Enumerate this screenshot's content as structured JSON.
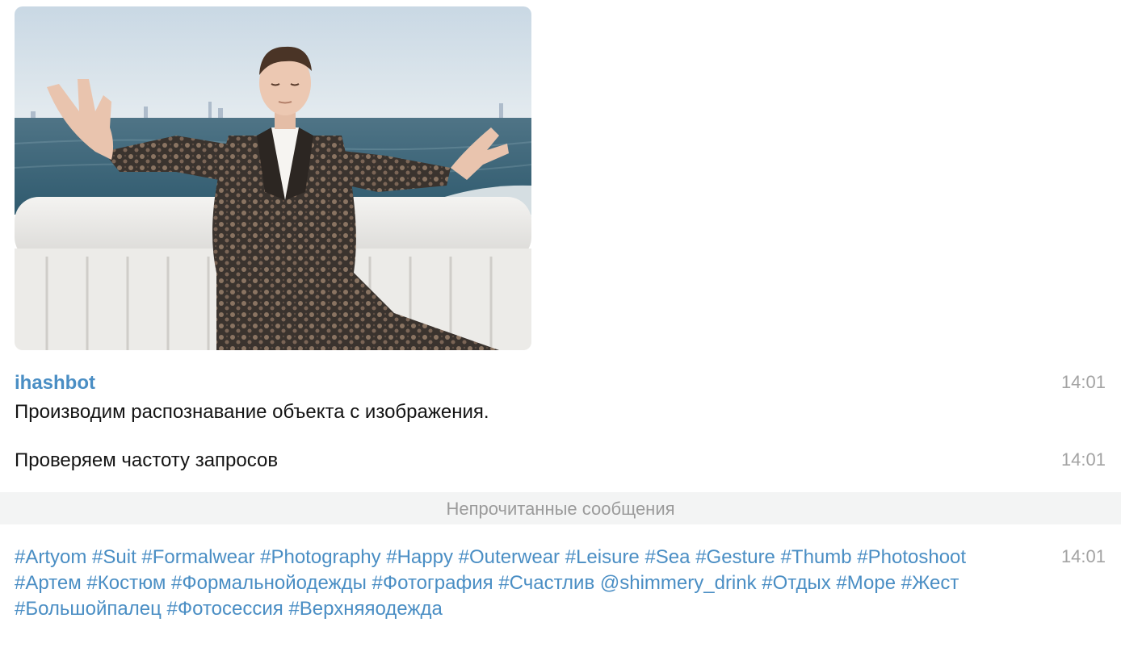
{
  "photo": {
    "alt_subject": "photo"
  },
  "messages": [
    {
      "sender": "ihashbot",
      "text": "Производим распознавание объекта с изображения.",
      "time": "14:01"
    },
    {
      "text": "Проверяем частоту запросов",
      "time": "14:01"
    }
  ],
  "unread_divider": {
    "label": "Непрочитанные сообщения"
  },
  "hashtag_message": {
    "time": "14:01",
    "tags": [
      "#Artyom",
      "#Suit",
      "#Formalwear",
      "#Photography",
      "#Happy",
      "#Outerwear",
      "#Leisure",
      "#Sea",
      "#Gesture",
      "#Thumb",
      "#Photoshoot",
      "#Артем",
      "#Костюм",
      "#Формальнойодежды",
      "#Фотография",
      "#Счастлив",
      "@shimmery_drink",
      "#Отдых",
      "#Море",
      "#Жест",
      "#Большойпалец",
      "#Фотосессия",
      "#Верхняяодежда"
    ]
  },
  "colors": {
    "link": "#4a8ec4",
    "time": "#a3a3a3",
    "divider_bg": "#f3f4f4"
  }
}
